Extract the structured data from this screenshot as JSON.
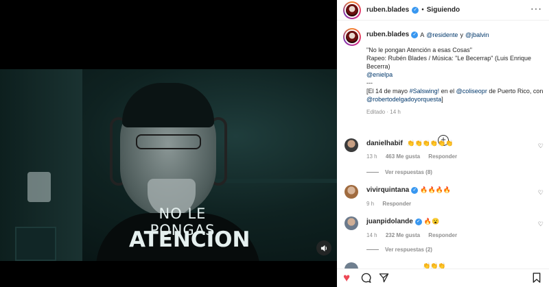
{
  "post": {
    "video": {
      "shirt_line1": "NO LE PONGAS",
      "shirt_line2": "ATENCION"
    },
    "mute_icon": "volume-icon",
    "header": {
      "username": "ruben.blades",
      "separator": "•",
      "follow_label": "Siguiendo",
      "more": "···"
    },
    "caption": {
      "username": "ruben.blades",
      "prefix": "A",
      "mention1": "@residente",
      "joiner": "y",
      "mention2": "@jbalvin",
      "line1": "\"No le pongan Atención a esas Cosas\"",
      "line2": "Rapeo: Rubén Blades / Música: \"Le Becerrap\" (Luis Enrique Becerra)",
      "mention3": "@enielpa",
      "dash": "---",
      "line4_pre": "[El 14 de mayo",
      "hashtag": "#Salswing!",
      "line4_mid": "en el",
      "mention4": "@coliseopr",
      "line4_post": "de Puerto Rico, con",
      "mention5": "@robertodelgadoyorquesta",
      "line4_end": "]",
      "meta": "Editado · 14 h"
    },
    "comments": [
      {
        "username": "danielhabif",
        "text": "👏👏👏👏👏👏",
        "time": "13 h",
        "likes": "463 Me gusta",
        "reply": "Responder",
        "replies": "Ver respuestas (8)"
      },
      {
        "username": "vivirquintana",
        "text": "🔥🔥🔥🔥",
        "time": "9 h",
        "reply": "Responder"
      },
      {
        "username": "juanpidolande",
        "text": "🔥😮",
        "time": "14 h",
        "likes": "232 Me gusta",
        "reply": "Responder",
        "replies": "Ver respuestas (2)"
      }
    ],
    "partial_comment_text": "👏👏👏"
  },
  "colors": {
    "like_red": "#ed4956",
    "link_blue": "#00376b",
    "verified_blue": "#3897f0",
    "meta_gray": "#8e8e8e"
  }
}
